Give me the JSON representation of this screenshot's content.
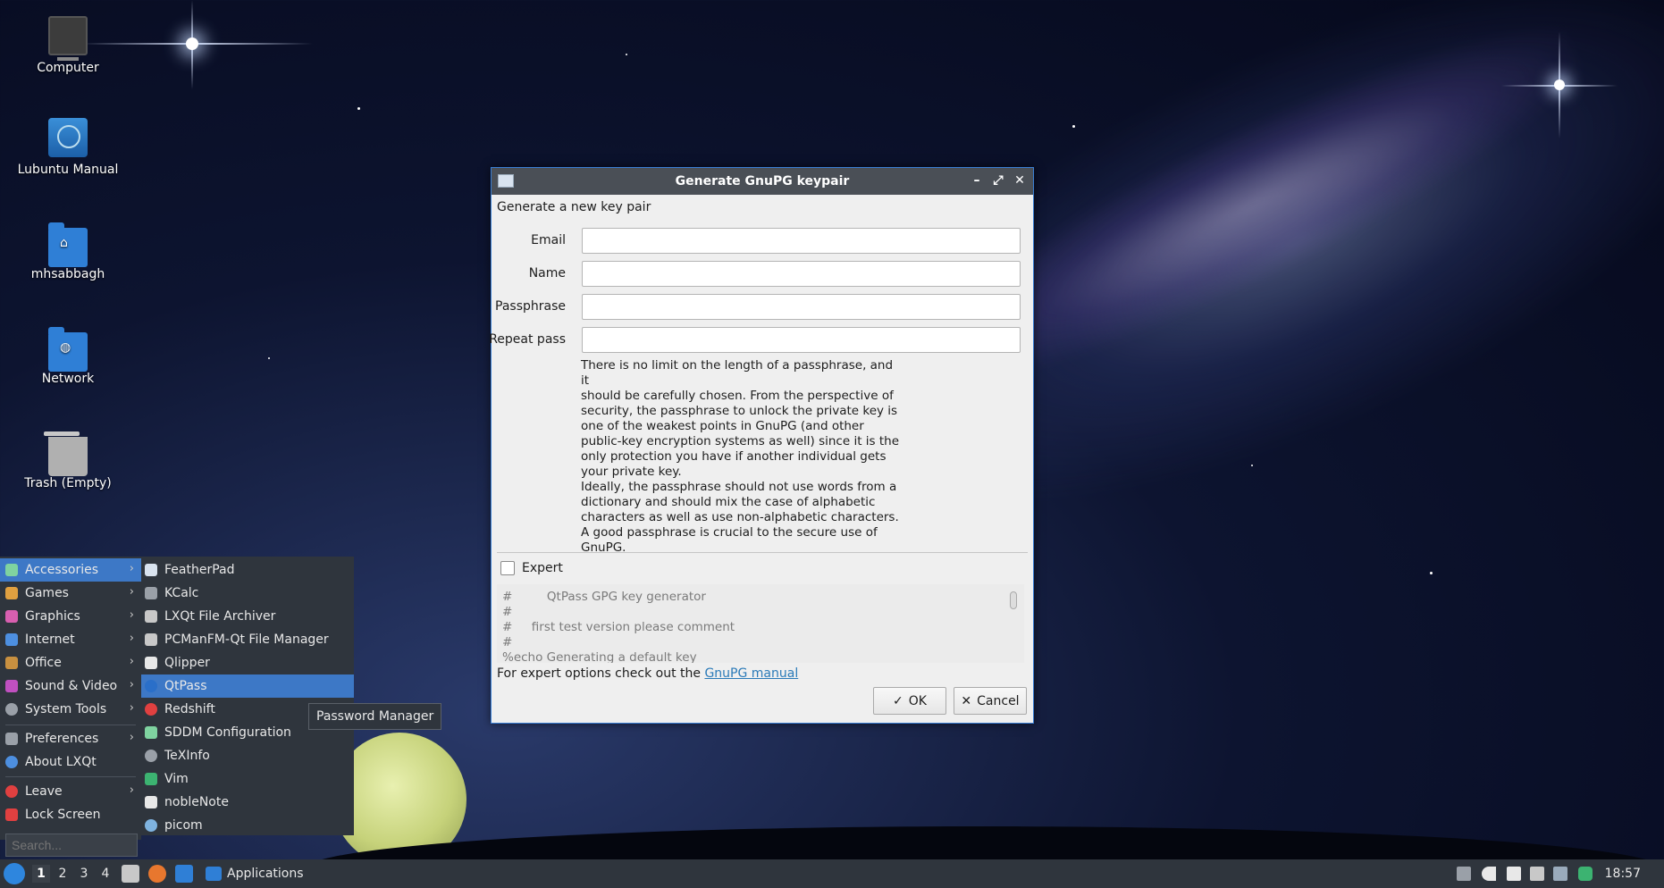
{
  "desktop": {
    "icons": [
      {
        "label": "Computer"
      },
      {
        "label": "Lubuntu Manual"
      },
      {
        "label": "mhsabbagh"
      },
      {
        "label": "Network"
      },
      {
        "label": "Trash (Empty)"
      }
    ]
  },
  "dialog": {
    "title": "Generate GnuPG keypair",
    "subtitle": "Generate a new key pair",
    "fields": [
      {
        "label": "Email",
        "value": ""
      },
      {
        "label": "Name",
        "value": ""
      },
      {
        "label": "Passphrase",
        "value": ""
      },
      {
        "label": "Repeat pass",
        "value": ""
      }
    ],
    "help_text": "There is no limit on the length of a passphrase, and it\nshould be carefully chosen. From the perspective of\nsecurity, the passphrase to unlock the private key is\none of the weakest points in GnuPG (and other\npublic-key encryption systems as well) since it is the\nonly protection you have if another individual gets\nyour private key.\nIdeally, the passphrase should not use words from a\ndictionary and should mix the case of alphabetic\ncharacters as well as use non-alphabetic characters.\nA good passphrase is crucial to the secure use of\nGnuPG.",
    "expert_label": "Expert",
    "expert_checked": false,
    "script_lines": [
      "#         QtPass GPG key generator",
      "#",
      "#     first test version please comment",
      "#",
      "%echo Generating a default key"
    ],
    "expert_note": "For expert options check out the ",
    "expert_link": "GnuPG manual",
    "ok_label": "OK",
    "cancel_label": "Cancel",
    "ok_icon": "✓",
    "cancel_icon": "✕"
  },
  "menu": {
    "categories": [
      {
        "label": "Accessories",
        "color": "#7fd3a0"
      },
      {
        "label": "Games",
        "color": "#e0a040"
      },
      {
        "label": "Graphics",
        "color": "#d85fb0"
      },
      {
        "label": "Internet",
        "color": "#4d8fe0"
      },
      {
        "label": "Office",
        "color": "#c89040"
      },
      {
        "label": "Sound & Video",
        "color": "#c050c0"
      },
      {
        "label": "System Tools",
        "color": "#9aa0a8"
      }
    ],
    "bottom_items": [
      {
        "label": "Preferences",
        "color": "#9aa0a8"
      },
      {
        "label": "About LXQt",
        "color": "#4d8fe0"
      },
      {
        "label": "Leave",
        "color": "#e04040"
      },
      {
        "label": "Lock Screen",
        "color": "#e04040"
      }
    ],
    "search_placeholder": "Search...",
    "accessories": [
      {
        "label": "FeatherPad",
        "color": "#d9e3ef"
      },
      {
        "label": "KCalc",
        "color": "#9aa0a8"
      },
      {
        "label": "LXQt File Archiver",
        "color": "#c8c8c8"
      },
      {
        "label": "PCManFM-Qt File Manager",
        "color": "#c8c8c8"
      },
      {
        "label": "Qlipper",
        "color": "#e8e8e8"
      },
      {
        "label": "QtPass",
        "color": "#2a6fc9"
      },
      {
        "label": "Redshift",
        "color": "#e04040"
      },
      {
        "label": "SDDM Configuration",
        "color": "#7fd3a0"
      },
      {
        "label": "TeXInfo",
        "color": "#9aa0a8"
      },
      {
        "label": "Vim",
        "color": "#3cb371"
      },
      {
        "label": "nobleNote",
        "color": "#e8e8e8"
      },
      {
        "label": "picom",
        "color": "#7fb3e0"
      }
    ],
    "tooltip": "Password Manager"
  },
  "taskbar": {
    "desktops": [
      "1",
      "2",
      "3",
      "4"
    ],
    "task_label": "Applications",
    "clock": "18:57"
  }
}
